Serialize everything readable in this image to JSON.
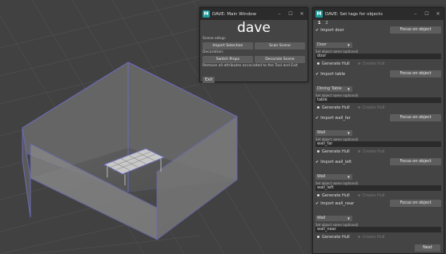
{
  "main_window": {
    "title": "DAVE: Main Window",
    "logo": "dave",
    "scene_setup_label": "Scene setup:",
    "import_selection": "Import Selection",
    "scan_scene": "Scan Scene",
    "decoration_label": "Decoration:",
    "switch_props": "Switch Props",
    "decorate_scene": "Decorate Scene",
    "remove_note": "Remove all attributes accociated to the Tool and Exit",
    "exit": "Exit"
  },
  "tags_window": {
    "title": "DAVE: Set tags for objects",
    "tabs": [
      "1",
      "2"
    ],
    "hint": "Set object name (optional)",
    "focus_label": "Focus on object",
    "generate_hull": "Generate Hull",
    "create_hull": "Create Hull",
    "next": "Next",
    "objects": [
      {
        "import_label": "Import door",
        "tag": "Door",
        "name": "door"
      },
      {
        "import_label": "Import table",
        "tag": "Dining Table",
        "name": "table"
      },
      {
        "import_label": "Import wall_far",
        "tag": "Wall",
        "name": "wall_far"
      },
      {
        "import_label": "Import wall_left",
        "tag": "Wall",
        "name": "wall_left"
      },
      {
        "import_label": "Import wall_near",
        "tag": "Wall",
        "name": "wall_near"
      }
    ]
  },
  "window_controls": {
    "minimize": "–",
    "maximize": "☐",
    "close": "✕"
  },
  "colors": {
    "logo": "#1f9c9c",
    "panel": "#444444",
    "titlebar": "#2b2b2b"
  }
}
